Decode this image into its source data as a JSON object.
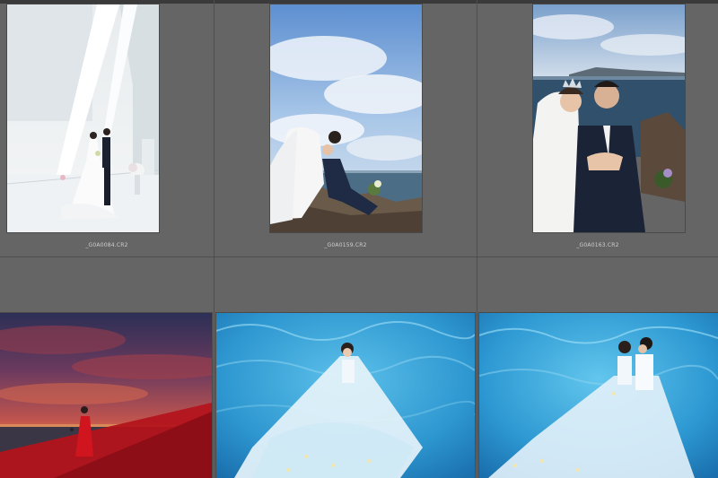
{
  "grid": {
    "items": [
      {
        "filename": "_G0A0084.CR2",
        "scene": "church-white-interior"
      },
      {
        "filename": "_G0A0159.CR2",
        "scene": "rocky-shore-sky"
      },
      {
        "filename": "_G0A0163.CR2",
        "scene": "seaside-crown-closeup"
      },
      {
        "filename": "",
        "scene": "red-sunset-gown"
      },
      {
        "filename": "",
        "scene": "underwater-bride"
      },
      {
        "filename": "",
        "scene": "underwater-couple"
      }
    ]
  },
  "colors": {
    "background": "#5f5f5f",
    "cell": "#656565",
    "divider": "#4e4e4e",
    "caption": "#cfcfcf"
  }
}
